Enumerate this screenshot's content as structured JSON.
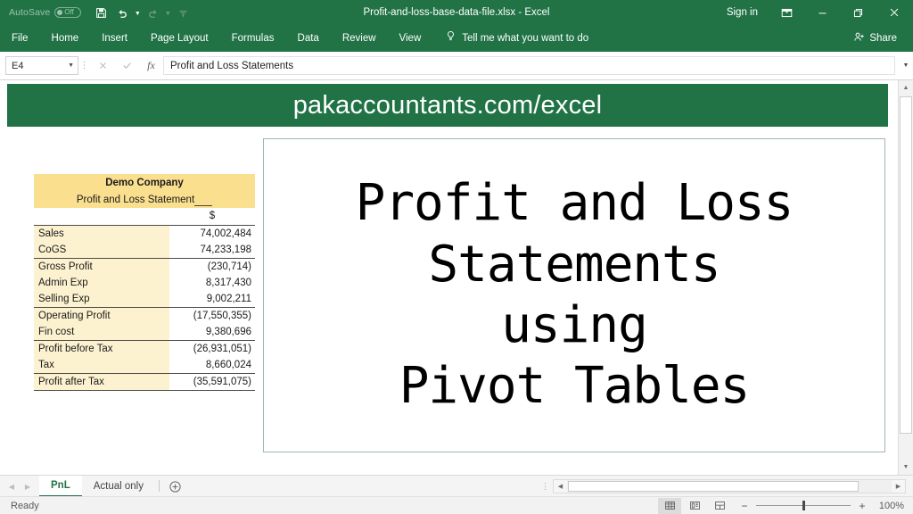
{
  "titlebar": {
    "autosave_label": "AutoSave",
    "autosave_state": "Off",
    "document_title": "Profit-and-loss-base-data-file.xlsx  -  Excel",
    "signin_label": "Sign in",
    "qat": [
      {
        "name": "save-icon",
        "label": "Save"
      },
      {
        "name": "undo-icon",
        "label": "Undo"
      },
      {
        "name": "redo-icon",
        "label": "Redo"
      },
      {
        "name": "customize-qat-icon",
        "label": "Customize Quick Access Toolbar"
      }
    ],
    "window_controls": [
      {
        "name": "ribbon-display-options-icon",
        "label": "Ribbon Display Options"
      },
      {
        "name": "minimize-icon",
        "label": "Minimize"
      },
      {
        "name": "restore-icon",
        "label": "Restore Down"
      },
      {
        "name": "close-icon",
        "label": "Close"
      }
    ]
  },
  "ribbon": {
    "tabs": [
      "File",
      "Home",
      "Insert",
      "Page Layout",
      "Formulas",
      "Data",
      "Review",
      "View"
    ],
    "tellme_placeholder": "Tell me what you want to do",
    "share_label": "Share"
  },
  "formulabar": {
    "name_box_value": "E4",
    "formula_value": "Profit and Loss Statements",
    "cancel_label": "Cancel",
    "enter_label": "Enter",
    "fx_label": "Insert Function"
  },
  "sheet": {
    "banner_text": "pakaccountants.com/excel",
    "textbox_lines": [
      "Profit and Loss",
      "Statements",
      "using",
      "Pivot Tables"
    ]
  },
  "pnl_table": {
    "company": "Demo Company",
    "subtitle": "Profit and Loss Statement",
    "currency_header": "$",
    "rows": [
      {
        "label": "Sales",
        "value": "74,002,484",
        "top_rule": true,
        "bottom_rule": false
      },
      {
        "label": "CoGS",
        "value": "74,233,198",
        "top_rule": false,
        "bottom_rule": false
      },
      {
        "label": "Gross Profit",
        "value": "(230,714)",
        "top_rule": true,
        "bottom_rule": false
      },
      {
        "label": "Admin Exp",
        "value": "8,317,430",
        "top_rule": false,
        "bottom_rule": false
      },
      {
        "label": "Selling Exp",
        "value": "9,002,211",
        "top_rule": false,
        "bottom_rule": false
      },
      {
        "label": "Operating Profit",
        "value": "(17,550,355)",
        "top_rule": true,
        "bottom_rule": false
      },
      {
        "label": "Fin cost",
        "value": "9,380,696",
        "top_rule": false,
        "bottom_rule": false
      },
      {
        "label": "Profit before Tax",
        "value": "(26,931,051)",
        "top_rule": true,
        "bottom_rule": false
      },
      {
        "label": "Tax",
        "value": "8,660,024",
        "top_rule": false,
        "bottom_rule": false
      },
      {
        "label": "Profit after Tax",
        "value": "(35,591,075)",
        "top_rule": true,
        "bottom_rule": true
      }
    ]
  },
  "tabbar": {
    "sheets": [
      {
        "label": "PnL",
        "active": true
      },
      {
        "label": "Actual only",
        "active": false
      }
    ],
    "add_sheet_label": "+",
    "prev_arrow": "◀",
    "next_arrow": "▶"
  },
  "statusbar": {
    "status_text": "Ready",
    "views": [
      {
        "name": "normal-view-icon",
        "label": "Normal",
        "active": true
      },
      {
        "name": "page-layout-view-icon",
        "label": "Page Layout",
        "active": false
      },
      {
        "name": "page-break-view-icon",
        "label": "Page Break Preview",
        "active": false
      }
    ],
    "zoom_out_label": "−",
    "zoom_in_label": "+",
    "zoom_value": "100%"
  },
  "colors": {
    "excel_green": "#217346",
    "table_header": "#fadf8e",
    "table_label": "#fdf2d0",
    "accent_text": "#ffffff"
  }
}
